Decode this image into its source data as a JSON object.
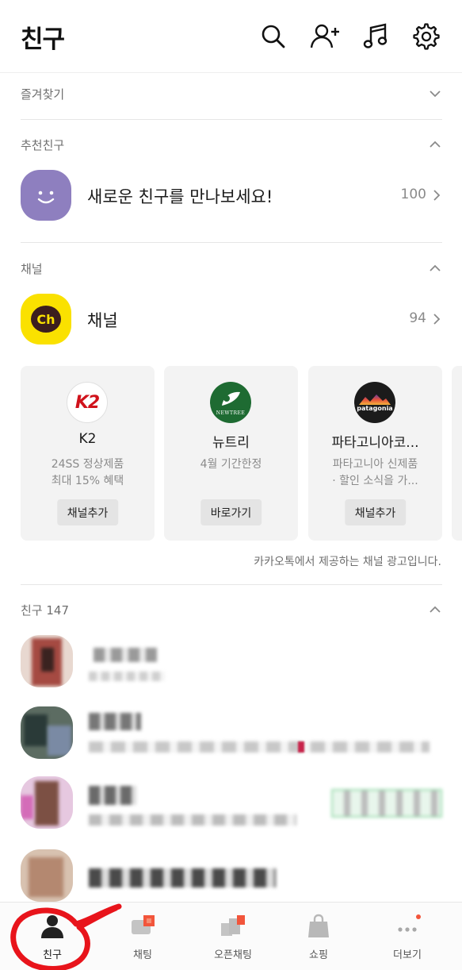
{
  "header": {
    "title": "친구",
    "icons": [
      "search-icon",
      "add-friend-icon",
      "music-icon",
      "settings-icon"
    ]
  },
  "favorites": {
    "label": "즐겨찾기"
  },
  "recommended": {
    "label": "추천친구",
    "row_title": "새로운 친구를 만나보세요!",
    "count": "100"
  },
  "channel": {
    "label": "채널",
    "row_title": "채널",
    "count": "94",
    "logo_text": "Ch",
    "cards": [
      {
        "logo_text": "K2",
        "name": "K2",
        "desc1": "24SS 정상제품",
        "desc2": "최대 15% 혜택",
        "button": "채널추가"
      },
      {
        "logo_text": "NEWTREE",
        "name": "뉴트리",
        "desc1": "4월 기간한정",
        "desc2": "",
        "button": "바로가기"
      },
      {
        "logo_text": "patagonia",
        "name": "파타고니아코...",
        "desc1": "파타고니아 신제품",
        "desc2": "· 할인 소식을 가...",
        "button": "채널추가"
      }
    ],
    "ad_note": "카카오톡에서 제공하는 채널 광고입니다."
  },
  "friends": {
    "label": "친구 147"
  },
  "tabs": [
    {
      "label": "친구",
      "icon": "person-icon",
      "active": true
    },
    {
      "label": "채팅",
      "icon": "chat-icon",
      "active": false
    },
    {
      "label": "오픈채팅",
      "icon": "open-chat-icon",
      "active": false
    },
    {
      "label": "쇼핑",
      "icon": "shopping-bag-icon",
      "active": false
    },
    {
      "label": "더보기",
      "icon": "more-icon",
      "active": false
    }
  ],
  "colors": {
    "kakao_yellow": "#fae100",
    "recommend_purple": "#8e7fbf",
    "badge_orange": "#f2553b",
    "annotation_red": "#e8141b"
  }
}
